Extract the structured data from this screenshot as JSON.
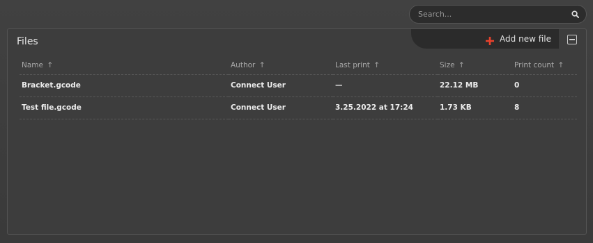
{
  "search": {
    "placeholder": "Search..."
  },
  "panel": {
    "title": "Files",
    "add_label": "Add new file",
    "accent": "#e8412c"
  },
  "table": {
    "columns": [
      {
        "label": "Name",
        "sort": "↑"
      },
      {
        "label": "Author",
        "sort": "↑"
      },
      {
        "label": "Last print",
        "sort": "↑"
      },
      {
        "label": "Size",
        "sort": "↑"
      },
      {
        "label": "Print count",
        "sort": "↑"
      }
    ],
    "rows": [
      {
        "name": "Bracket.gcode",
        "author": "Connect User",
        "last_print": "—",
        "size": "22.12 MB",
        "count": "0"
      },
      {
        "name": "Test file.gcode",
        "author": "Connect User",
        "last_print": "3.25.2022 at 17:24",
        "size": "1.73 KB",
        "count": "8"
      }
    ]
  }
}
